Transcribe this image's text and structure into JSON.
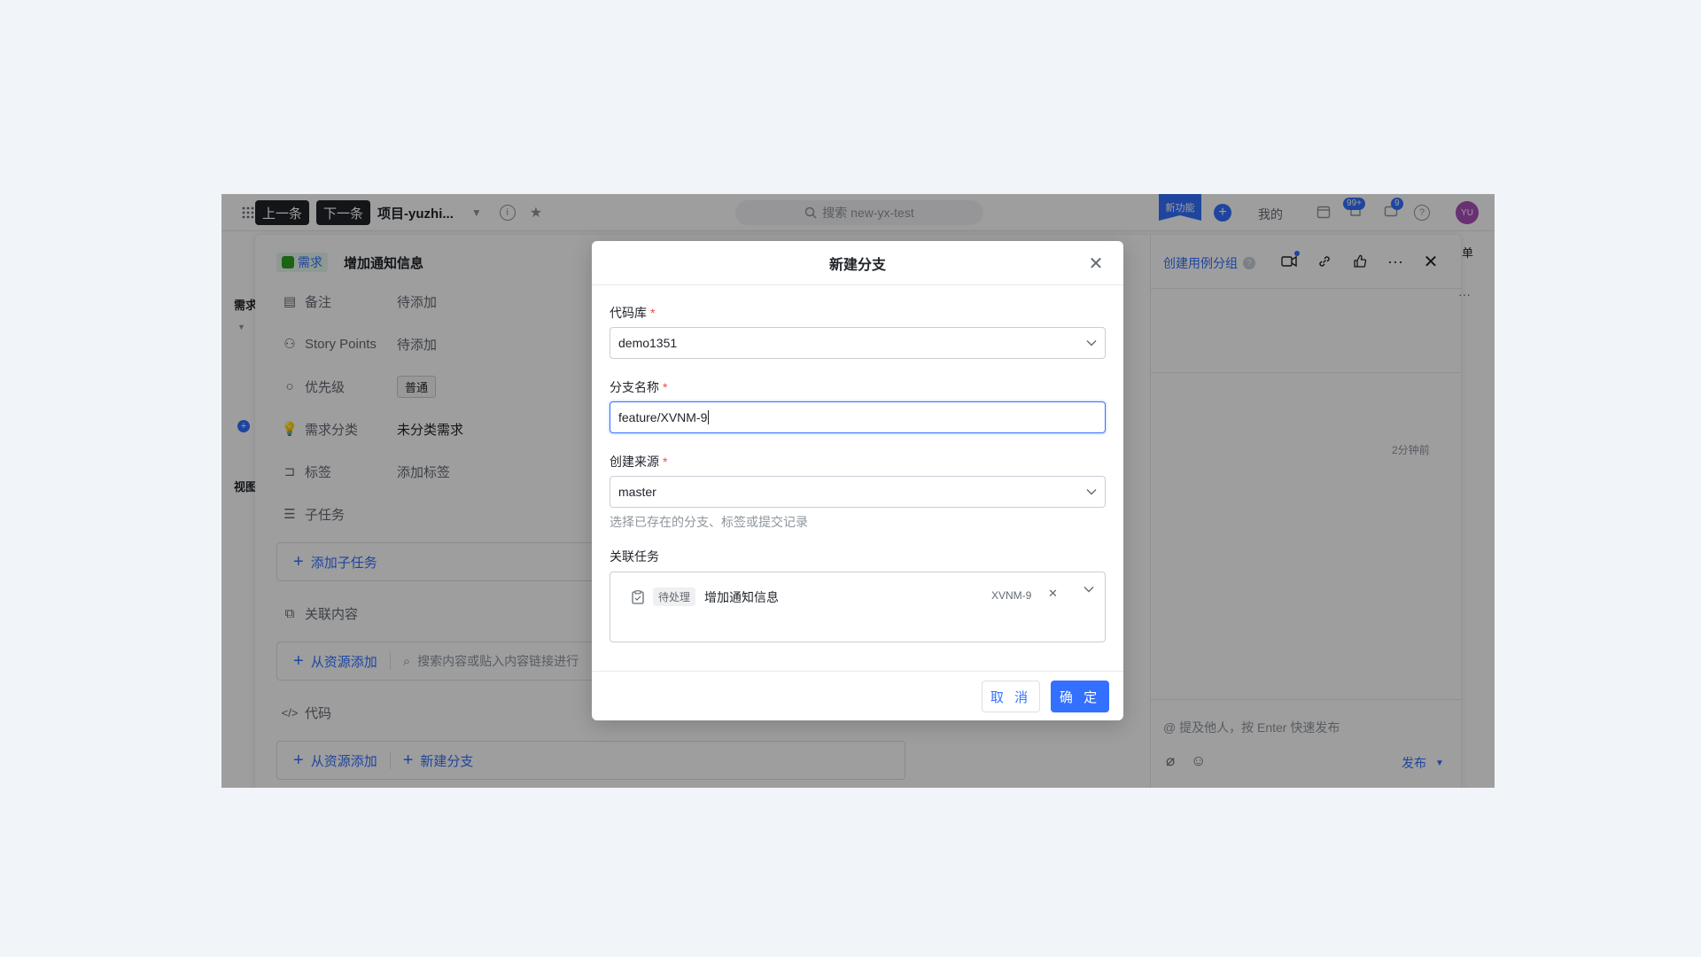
{
  "topbar": {
    "prev_label": "上一条",
    "next_label": "下一条",
    "project_name": "项目-yuzhi...",
    "search_placeholder": "搜索 new-yx-test",
    "new_feature_label": "新功能",
    "my_label": "我的",
    "notif_count": "99+",
    "msg_count": "9",
    "avatar_text": "YU",
    "right_edge_text": "单"
  },
  "left_strip": {
    "label_1": "需求",
    "label_2": "视图"
  },
  "drawer": {
    "type_tag": "需求",
    "title": "增加通知信息",
    "create_group_label": "创建用例分组",
    "fields": [
      {
        "label": "备注",
        "value": "待添加"
      },
      {
        "label": "Story Points",
        "value": "待添加"
      },
      {
        "label": "优先级",
        "value": "普通"
      },
      {
        "label": "需求分类",
        "value": "未分类需求"
      },
      {
        "label": "标签",
        "value": "添加标签"
      },
      {
        "label": "子任务",
        "value": ""
      }
    ],
    "add_subtask_label": "添加子任务",
    "related_content_label": "关联内容",
    "add_from_resource_label": "从资源添加",
    "search_related_placeholder": "搜索内容或贴入内容链接进行",
    "code_label": "代码",
    "add_from_resource_label_2": "从资源添加",
    "new_branch_label": "新建分支",
    "time_ago": "2分钟前",
    "comment_placeholder": "@ 提及他人，按 Enter 快速发布",
    "publish_label": "发布"
  },
  "modal": {
    "title": "新建分支",
    "repo_label": "代码库",
    "repo_value": "demo1351",
    "branch_label": "分支名称",
    "branch_value": "feature/XVNM-9",
    "source_label": "创建来源",
    "source_value": "master",
    "source_hint": "选择已存在的分支、标签或提交记录",
    "related_task_label": "关联任务",
    "task": {
      "status": "待处理",
      "title": "增加通知信息",
      "key": "XVNM-9"
    },
    "cancel_label": "取 消",
    "ok_label": "确 定"
  },
  "colors": {
    "accent": "#3370ff",
    "required": "#f54a45",
    "shade": "rgba(0,0,0,0.38)"
  }
}
